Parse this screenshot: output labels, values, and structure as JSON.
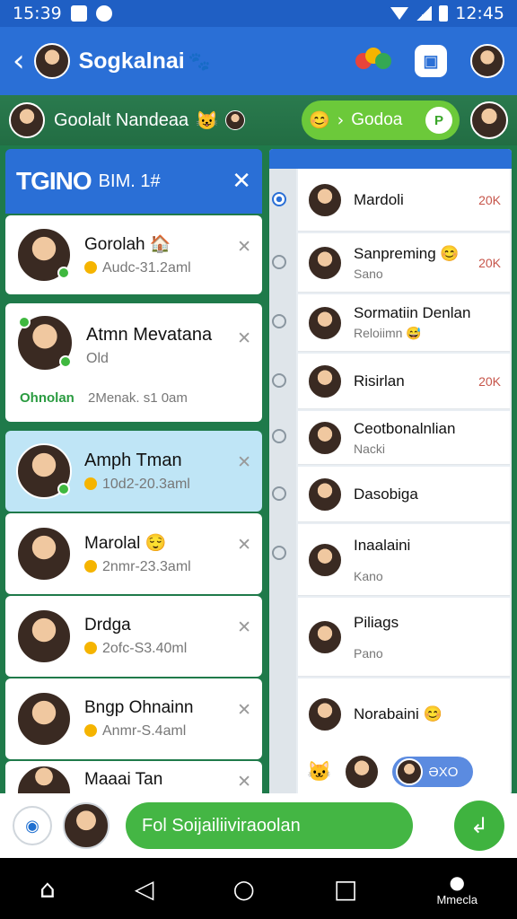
{
  "statusbar": {
    "time": "15:39",
    "clock": "12:45"
  },
  "appbar": {
    "title": "Sogkalnai",
    "title_emoji": "🐾"
  },
  "subbar": {
    "name": "Goolalt Nandeaa",
    "emoji": "😺",
    "pill_label": "Godoa",
    "pill_left_emoji": "😊",
    "pill_right_glyph": "P"
  },
  "left_panel": {
    "header_title": "TGINO",
    "header_sub": "BIM. 1#",
    "close_icon": "✕",
    "cards": [
      {
        "name": "Gorolah 🏠",
        "sub": "Audc-31.2aml"
      },
      {
        "name": "Atmn Mevatana",
        "sub": "Old",
        "status": "Ohnolan",
        "status2": "2Menak. s1 0am"
      },
      {
        "name": "Amph Tman",
        "sub": "10d2-20.3aml"
      },
      {
        "name": "Marolal 😌",
        "sub": "2nmr-23.3aml"
      },
      {
        "name": "Drdga",
        "sub": "2ofc-S3.40ml"
      },
      {
        "name": "Bngp Ohnainn",
        "sub": "Anmr-S.4aml"
      },
      {
        "name": "Maaai Tan",
        "sub": ""
      }
    ]
  },
  "right_panel": {
    "rows": [
      {
        "name": "Mardoli",
        "sub": "",
        "count": "20K"
      },
      {
        "name": "Sanpreming 😊",
        "sub": "Sano",
        "count": "20K"
      },
      {
        "name": "Sormatiin Denlan",
        "sub": "Reloiimn 😅",
        "count": ""
      },
      {
        "name": "Risirlan",
        "sub": "",
        "count": "20K"
      },
      {
        "name": "Ceotbonalnlian",
        "sub": "Nacki",
        "count": ""
      },
      {
        "name": "Dasobiga",
        "sub": "",
        "count": ""
      },
      {
        "name": "Inaalaini",
        "sub": "Kano",
        "count": ""
      },
      {
        "name": "Piliags",
        "sub": "Pano",
        "count": ""
      },
      {
        "name": "Norabaini 😊",
        "sub": "",
        "count": ""
      }
    ],
    "toggle_label": "ƏXO"
  },
  "composer": {
    "input_text": "Fol Soijailiiviraoolan",
    "send_glyph": "↲"
  },
  "navbar": {
    "profile_label": "Mmecla"
  },
  "colors": {
    "appbar": "#2a6fd6",
    "accent_green": "#44b644",
    "selected_row": "#bfe5f6"
  }
}
